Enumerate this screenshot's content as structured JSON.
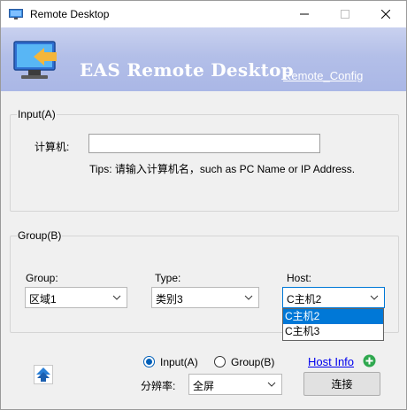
{
  "window": {
    "title": "Remote Desktop"
  },
  "banner": {
    "title": "EAS Remote Desktop",
    "config_link": "Remote_Config"
  },
  "input_group": {
    "legend": "Input(A)",
    "computer_label": "计算机:",
    "computer_value": "",
    "tips": "Tips: 请输入计算机名，such as PC Name or IP Address."
  },
  "group_group": {
    "legend": "Group(B)",
    "group_label": "Group:",
    "group_value": "区域1",
    "type_label": "Type:",
    "type_value": "类别3",
    "host_label": "Host:",
    "host_value": "C主机2",
    "host_options": [
      "C主机2",
      "C主机3"
    ],
    "host_selected_index": 0
  },
  "bottom": {
    "radio_input_label": "Input(A)",
    "radio_group_label": "Group(B)",
    "selected_mode": "Input(A)",
    "host_info_link": "Host Info",
    "resolution_label": "分辨率:",
    "resolution_value": "全屏",
    "connect_label": "连接"
  },
  "colors": {
    "accent": "#0078d7",
    "banner_light": "#c9d1ef",
    "banner_dark": "#aab7e6",
    "link": "#0000ee",
    "plus_green": "#2fa84f"
  },
  "icons": {
    "app": "monitor-arrow-icon",
    "banner_logo": "monitor-arrow-icon",
    "minimize": "minimize-icon",
    "maximize": "maximize-icon",
    "close": "close-icon",
    "host_info_add": "plus-circle-icon",
    "upload": "up-arrow-icon",
    "dropdown": "chevron-down-icon"
  }
}
